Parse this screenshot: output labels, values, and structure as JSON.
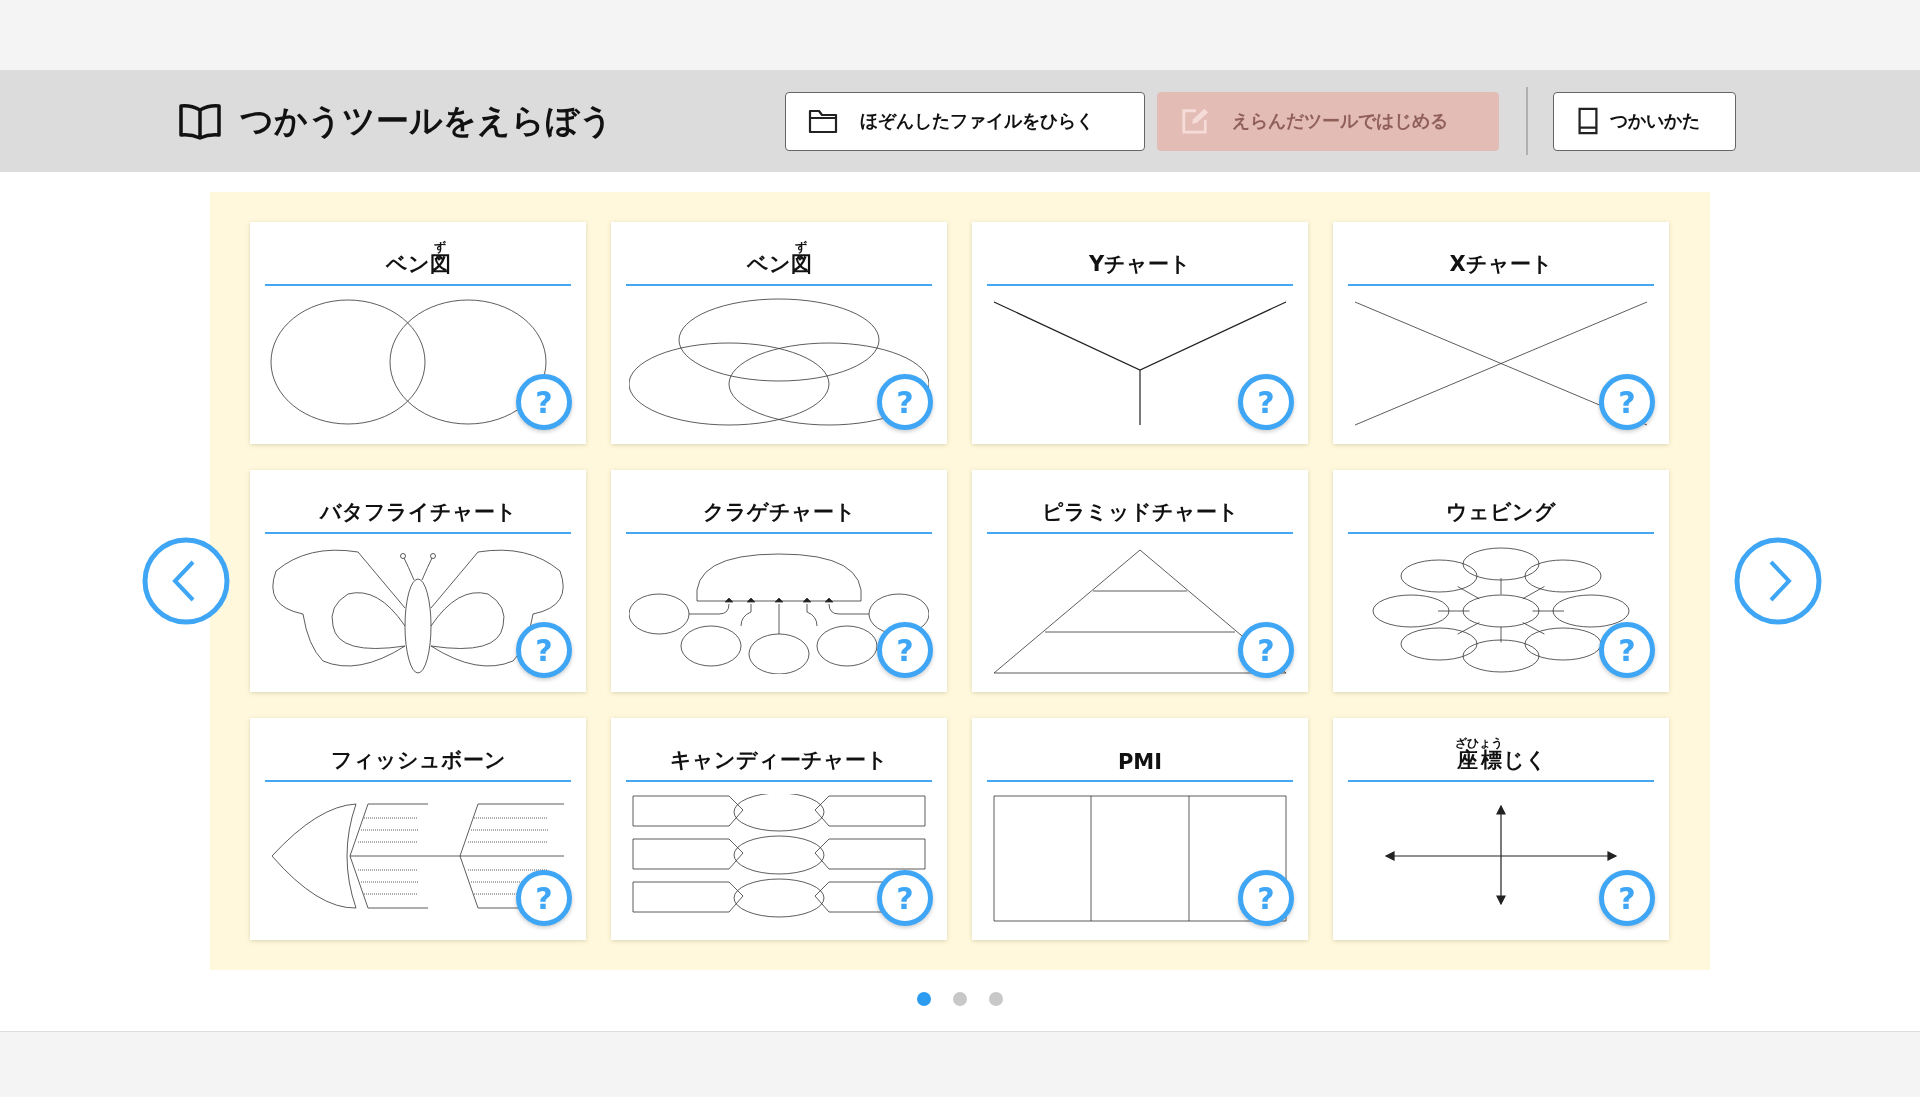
{
  "header": {
    "title": "つかうツールをえらぼう",
    "buttons": [
      {
        "kind": "open",
        "label": "ほぞんしたファイルをひらく",
        "disabled": false
      },
      {
        "kind": "start",
        "label": "えらんだツールではじめる",
        "disabled": true
      },
      {
        "kind": "guide",
        "label": "つかいかた",
        "disabled": false
      }
    ]
  },
  "tools": [
    {
      "kind": "venn2",
      "title": [
        {
          "text": "ベン"
        },
        {
          "text": "図",
          "ruby": "ず"
        }
      ],
      "help": "?"
    },
    {
      "kind": "venn3",
      "title": [
        {
          "text": "ベン"
        },
        {
          "text": "図",
          "ruby": "ず"
        }
      ],
      "help": "?"
    },
    {
      "kind": "ychart",
      "title": [
        {
          "text": "Yチャート"
        }
      ],
      "help": "?"
    },
    {
      "kind": "xchart",
      "title": [
        {
          "text": "Xチャート"
        }
      ],
      "help": "?"
    },
    {
      "kind": "butterfly",
      "title": [
        {
          "text": "バタフライチャート"
        }
      ],
      "help": "?"
    },
    {
      "kind": "jellyfish",
      "title": [
        {
          "text": "クラゲチャート"
        }
      ],
      "help": "?"
    },
    {
      "kind": "pyramid",
      "title": [
        {
          "text": "ピラミッドチャート"
        }
      ],
      "help": "?"
    },
    {
      "kind": "webbing",
      "title": [
        {
          "text": "ウェビング"
        }
      ],
      "help": "?"
    },
    {
      "kind": "fishbone",
      "title": [
        {
          "text": "フィッシュボーン"
        }
      ],
      "help": "?"
    },
    {
      "kind": "candy",
      "title": [
        {
          "text": "キャンディーチャート"
        }
      ],
      "help": "?"
    },
    {
      "kind": "pmi",
      "title": [
        {
          "text": "PMI"
        }
      ],
      "help": "?"
    },
    {
      "kind": "axes",
      "title": [
        {
          "text": "座標",
          "ruby": "ざひょう"
        },
        {
          "text": "じく"
        }
      ],
      "help": "?"
    }
  ],
  "pages": [
    {
      "selected": true
    },
    {
      "selected": false
    },
    {
      "selected": false
    }
  ]
}
